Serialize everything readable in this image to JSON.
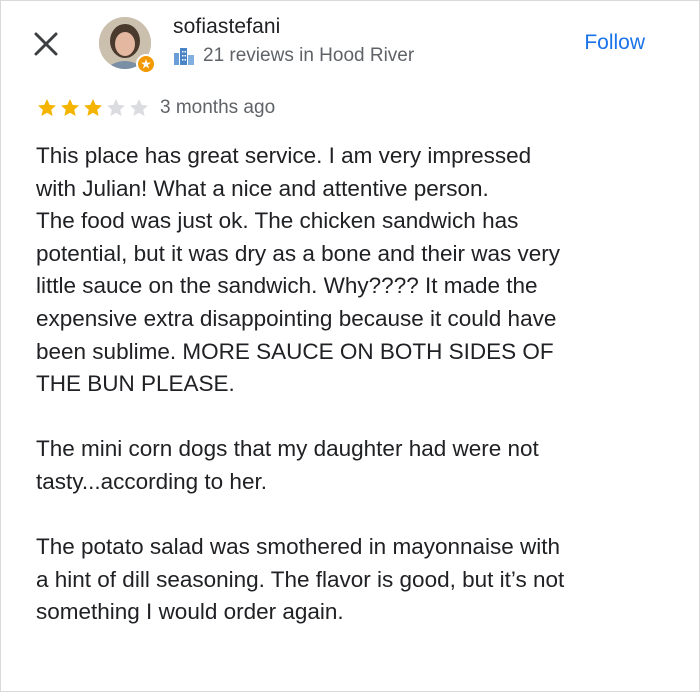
{
  "header": {
    "user_name": "sofiastefani",
    "reviews_summary": "21 reviews in Hood River",
    "follow_label": "Follow"
  },
  "rating": {
    "stars": 3,
    "max_stars": 5,
    "time_ago": "3 months ago"
  },
  "review": {
    "paragraph_1": "This place has great service. I am very impressed\nwith Julian! What a nice and attentive person.\nThe food was just ok. The chicken sandwich has\npotential, but it was dry as a bone and their was very\nlittle sauce on the sandwich. Why???? It made the\nexpensive extra disappointing because it could have\nbeen sublime. MORE SAUCE ON BOTH SIDES OF\nTHE BUN PLEASE.",
    "paragraph_2": "The mini corn dogs that my daughter had were not\ntasty...according to her.",
    "paragraph_3": "The potato salad was smothered in mayonnaise with\na hint of dill seasoning. The flavor is good, but it’s not\nsomething I would order again."
  },
  "colors": {
    "accent": "#1a73e8",
    "star_filled": "#f4b400",
    "star_empty": "#dadce0",
    "secondary_text": "#5f6368",
    "badge": "#f29900"
  },
  "icons": {
    "close": "close-icon",
    "local_guide": "local-guide-badge-icon",
    "reviews": "reviews-city-icon"
  }
}
